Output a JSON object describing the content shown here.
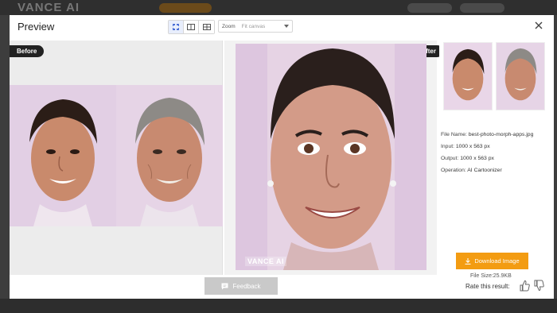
{
  "background": {
    "logo_text": "VANCE AI"
  },
  "modal": {
    "title": "Preview",
    "zoom_label": "Zoom",
    "zoom_value": "Fit canvas",
    "view_modes": [
      "side-by-side-icon",
      "split-view-icon",
      "grid-view-icon"
    ]
  },
  "panels": {
    "before_label": "Before",
    "after_label": "After",
    "watermark": "VANCE AI"
  },
  "info": {
    "file_name_label": "File Name:",
    "file_name": "best-photo-morph-apps.jpg",
    "input_label": "Input:",
    "input": "1000 x 563 px",
    "output_label": "Output:",
    "output": "1000 x 563 px",
    "operation_label": "Operation:",
    "operation": "AI Cartoonizer",
    "download_label": "Download Image",
    "file_size": "File Size:25.9KB"
  },
  "footer": {
    "feedback_label": "Feedback",
    "rate_label": "Rate this result:"
  },
  "colors": {
    "accent": "#f39c12",
    "dark_tag": "#222222",
    "backdrop": "#3d3d3d"
  }
}
